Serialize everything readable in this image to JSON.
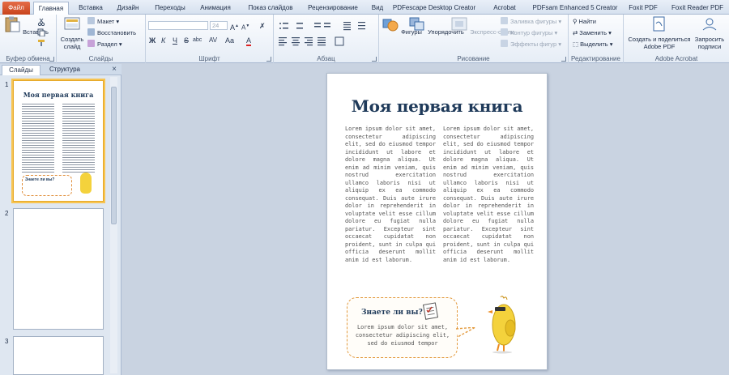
{
  "tabs": [
    {
      "label": "Файл",
      "kind": "file"
    },
    {
      "label": "Главная",
      "kind": "active"
    },
    {
      "label": "Вставка"
    },
    {
      "label": "Дизайн"
    },
    {
      "label": "Переходы"
    },
    {
      "label": "Анимация"
    },
    {
      "label": "Показ слайдов"
    },
    {
      "label": "Рецензирование"
    },
    {
      "label": "Вид"
    },
    {
      "label": "PDFescape Desktop Creator"
    },
    {
      "label": "Acrobat"
    },
    {
      "label": "PDFsam Enhanced 5 Creator"
    },
    {
      "label": "Foxit PDF"
    },
    {
      "label": "Foxit Reader PDF"
    }
  ],
  "ribbon": {
    "clipboard": {
      "paste": "Вставить",
      "label": "Буфер обмена"
    },
    "slides": {
      "create": "Создать",
      "create2": "слайд",
      "layout": "Макет",
      "reset": "Восстановить",
      "section": "Раздел",
      "label": "Слайды"
    },
    "font": {
      "size": "24",
      "bold": "Ж",
      "italic": "К",
      "underline": "Ч",
      "strike": "S",
      "shadow": "abc",
      "label": "Шрифт"
    },
    "paragraph": {
      "label": "Абзац"
    },
    "drawing": {
      "shapes": "Фигуры",
      "arrange": "Упорядочить",
      "styles": "Экспресс-стили",
      "fill": "Заливка фигуры",
      "outline": "Контур фигуры",
      "effects": "Эффекты фигур",
      "label": "Рисование"
    },
    "editing": {
      "find": "Найти",
      "replace": "Заменить",
      "select": "Выделить",
      "label": "Редактирование"
    },
    "acrobat": {
      "create": "Создать и поделиться",
      "create2": "Adobe PDF",
      "request": "Запросить",
      "request2": "подписи",
      "label": "Adobe Acrobat"
    }
  },
  "panel": {
    "tab_slides": "Слайды",
    "tab_outline": "Структура",
    "close": "×",
    "slide_numbers": [
      "1",
      "2",
      "3"
    ]
  },
  "slide": {
    "title": "Моя первая книга",
    "column_text": "Lorem ipsum dolor sit amet, consectetur adipiscing elit, sed do eiusmod tempor incididunt ut labore et dolore magna aliqua. Ut enim ad minim veniam, quis nostrud exercitation ullamco laboris nisi ut aliquip ex ea commodo consequat. Duis aute irure dolor in reprehenderit in voluptate velit esse cillum dolore eu fugiat nulla pariatur. Excepteur sint occaecat cupidatat non proident, sunt in culpa qui officia deserunt mollit anim id est laborum.",
    "bubble_title": "Знаете ли вы?",
    "bubble_text": "Lorem ipsum dolor sit amet, consectetur adipiscing elit, sed do eiusmod tempor"
  },
  "colors": {
    "file_tab": "#d4552d",
    "title": "#1f3a5a",
    "bubble_border": "#e39a3e",
    "chick": "#f4d23c",
    "thumb_selected": "#f7c451"
  }
}
